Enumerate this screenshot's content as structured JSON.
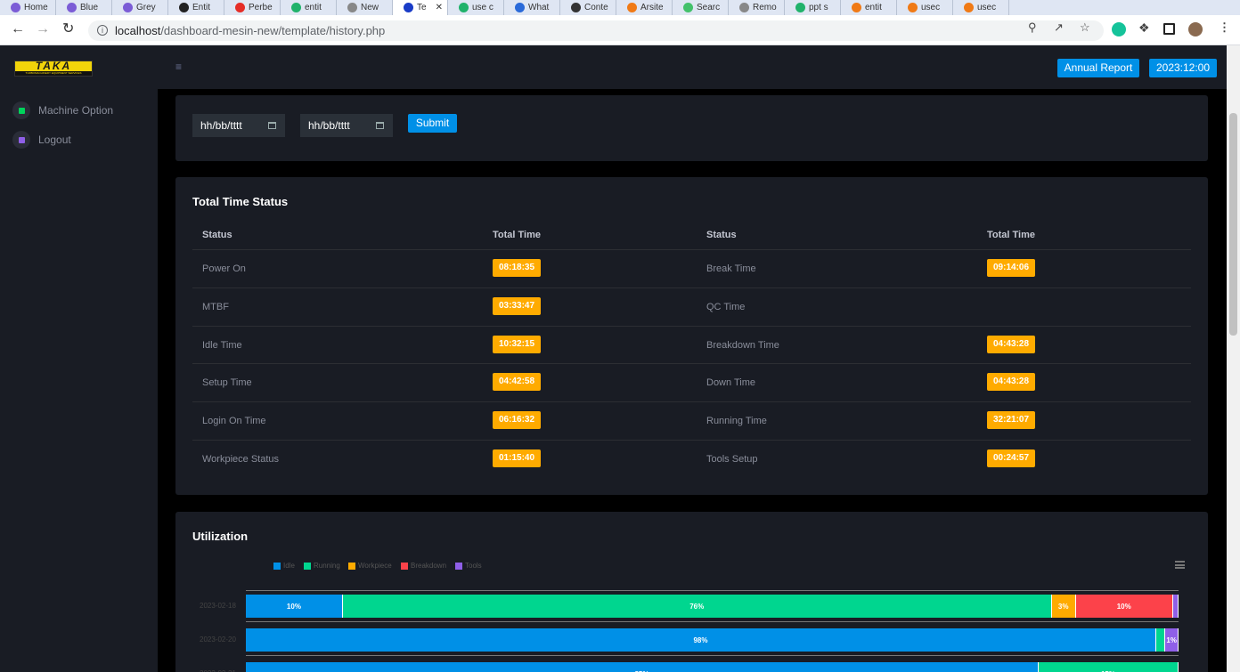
{
  "browser": {
    "tabs": [
      {
        "label": "Home",
        "color": "#7b5cd6"
      },
      {
        "label": "Blue",
        "color": "#7b5cd6"
      },
      {
        "label": "Grey",
        "color": "#7b5cd6"
      },
      {
        "label": "Entit",
        "color": "#222222"
      },
      {
        "label": "Perbe",
        "color": "#e52d27"
      },
      {
        "label": "entit",
        "color": "#20b26b"
      },
      {
        "label": "New",
        "color": "#888888"
      },
      {
        "label": "Te",
        "color": "#1a3cc7"
      },
      {
        "label": "use c",
        "color": "#20b26b"
      },
      {
        "label": "What",
        "color": "#2a6ad9"
      },
      {
        "label": "Conte",
        "color": "#333333"
      },
      {
        "label": "Arsite",
        "color": "#f07a16"
      },
      {
        "label": "Searc",
        "color": "#43c16b"
      },
      {
        "label": "Remo",
        "color": "#888888"
      },
      {
        "label": "ppt s",
        "color": "#20b26b"
      },
      {
        "label": "entit",
        "color": "#f07a16"
      },
      {
        "label": "usec",
        "color": "#f07a16"
      },
      {
        "label": "usec",
        "color": "#f07a16"
      }
    ],
    "url_host": "localhost",
    "url_path": "/dashboard-mesin-new/template/history.php"
  },
  "sidebar": {
    "logo_text": "TAKA",
    "logo_sub": "TURBOMACHINERY EQUIPMENT SERVICES",
    "items": [
      {
        "label": "Machine Option",
        "icon": "grid-icon",
        "color": "#00d25b"
      },
      {
        "label": "Logout",
        "icon": "logout-icon",
        "color": "#8f5fe8"
      }
    ]
  },
  "header": {
    "annual_report": "Annual Report",
    "datetime": "2023:12:00"
  },
  "filter": {
    "date_from_placeholder": "hh/bb/tttt",
    "date_to_placeholder": "hh/bb/tttt",
    "submit": "Submit"
  },
  "status_table": {
    "title": "Total Time Status",
    "headers": [
      "Status",
      "Total Time",
      "Status",
      "Total Time"
    ],
    "rows": [
      {
        "left": "Power On",
        "left_time": "08:18:35",
        "right": "Break Time",
        "right_time": "09:14:06"
      },
      {
        "left": "MTBF",
        "left_time": "03:33:47",
        "right": "QC Time",
        "right_time": ""
      },
      {
        "left": "Idle Time",
        "left_time": "10:32:15",
        "right": "Breakdown Time",
        "right_time": "04:43:28"
      },
      {
        "left": "Setup Time",
        "left_time": "04:42:58",
        "right": "Down Time",
        "right_time": "04:43:28"
      },
      {
        "left": "Login On Time",
        "left_time": "06:16:32",
        "right": "Running Time",
        "right_time": "32:21:07"
      },
      {
        "left": "Workpiece Status",
        "left_time": "01:15:40",
        "right": "Tools Setup",
        "right_time": "00:24:57"
      }
    ]
  },
  "utilization": {
    "title": "Utilization"
  },
  "chart_data": {
    "type": "bar",
    "stacked": true,
    "orientation": "horizontal",
    "title": "Utilization",
    "legend_position": "top-left",
    "categories": [
      "2023-02-18",
      "2023-02-20",
      "2023-02-21"
    ],
    "series": [
      {
        "name": "Idle",
        "color": "#0090e7",
        "values": [
          10.4,
          98,
          85
        ]
      },
      {
        "name": "Running",
        "color": "#00d68f",
        "values": [
          76,
          1,
          15
        ]
      },
      {
        "name": "Workpiece",
        "color": "#ffab00",
        "values": [
          2.6,
          0,
          0
        ]
      },
      {
        "name": "Breakdown",
        "color": "#fc424a",
        "values": [
          10.4,
          0,
          0
        ]
      },
      {
        "name": "Tools",
        "color": "#8f5fe8",
        "values": [
          0.6,
          1.4,
          0
        ]
      }
    ],
    "data_labels": [
      [
        "10%",
        "76%",
        "3%",
        "10%",
        ""
      ],
      [
        "98%",
        "",
        "",
        "",
        "1%"
      ],
      [
        "85%",
        "15%",
        "",
        "",
        ""
      ]
    ],
    "xlim": [
      0,
      100
    ]
  }
}
